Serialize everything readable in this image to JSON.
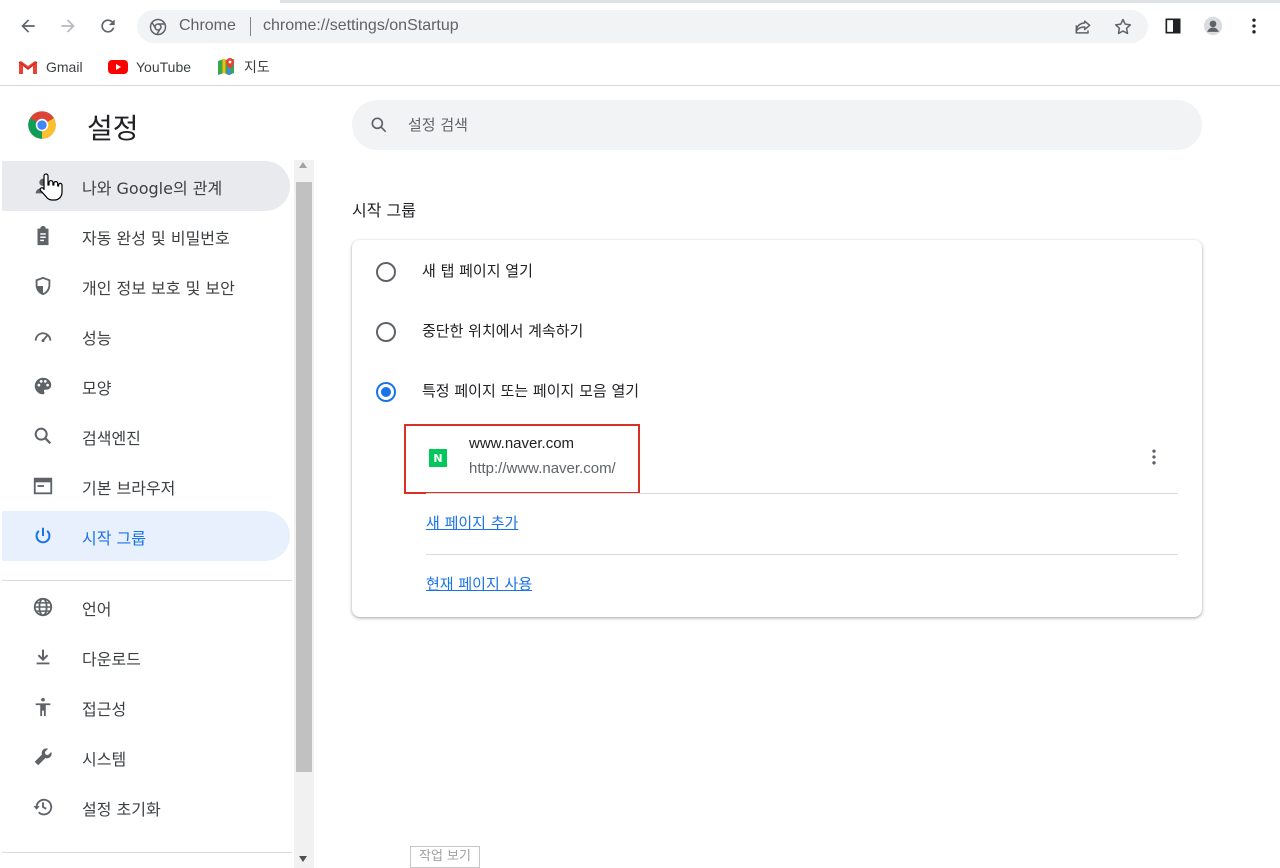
{
  "browser": {
    "nav": {
      "back": "back-arrow",
      "forward": "forward-arrow",
      "reload": "reload-icon"
    },
    "omnibox": {
      "chip": "Chrome",
      "url": "chrome://settings/onStartup"
    },
    "bookmarks": [
      {
        "label": "Gmail",
        "icon": "gmail-icon"
      },
      {
        "label": "YouTube",
        "icon": "youtube-icon"
      },
      {
        "label": "지도",
        "icon": "maps-icon"
      }
    ]
  },
  "settings": {
    "title": "설정",
    "search_placeholder": "설정 검색",
    "nav": [
      {
        "label": "나와 Google의 관계",
        "icon": "person-icon"
      },
      {
        "label": "자동 완성 및 비밀번호",
        "icon": "clipboard-icon"
      },
      {
        "label": "개인 정보 보호 및 보안",
        "icon": "shield-icon"
      },
      {
        "label": "성능",
        "icon": "speedometer-icon"
      },
      {
        "label": "모양",
        "icon": "palette-icon"
      },
      {
        "label": "검색엔진",
        "icon": "search-icon"
      },
      {
        "label": "기본 브라우저",
        "icon": "browser-icon"
      },
      {
        "label": "시작 그룹",
        "icon": "power-icon"
      },
      {
        "label": "언어",
        "icon": "globe-icon"
      },
      {
        "label": "다운로드",
        "icon": "download-icon"
      },
      {
        "label": "접근성",
        "icon": "accessibility-icon"
      },
      {
        "label": "시스템",
        "icon": "wrench-icon"
      },
      {
        "label": "설정 초기화",
        "icon": "history-icon"
      }
    ],
    "active_nav": "시작 그룹",
    "section_title": "시작 그룹",
    "options": [
      {
        "label": "새 탭 페이지 열기",
        "checked": false
      },
      {
        "label": "중단한 위치에서 계속하기",
        "checked": false
      },
      {
        "label": "특정 페이지 또는 페이지 모음 열기",
        "checked": true
      }
    ],
    "startup_pages": [
      {
        "title": "www.naver.com",
        "url": "http://www.naver.com/",
        "favicon": "N"
      }
    ],
    "add_page_link": "새 페이지 추가",
    "use_current_link": "현재 페이지 사용"
  },
  "tooltip": "작업 보기",
  "colors": {
    "accent": "#1a73e8",
    "highlight_border": "#d93025",
    "naver_green": "#03c75a"
  }
}
